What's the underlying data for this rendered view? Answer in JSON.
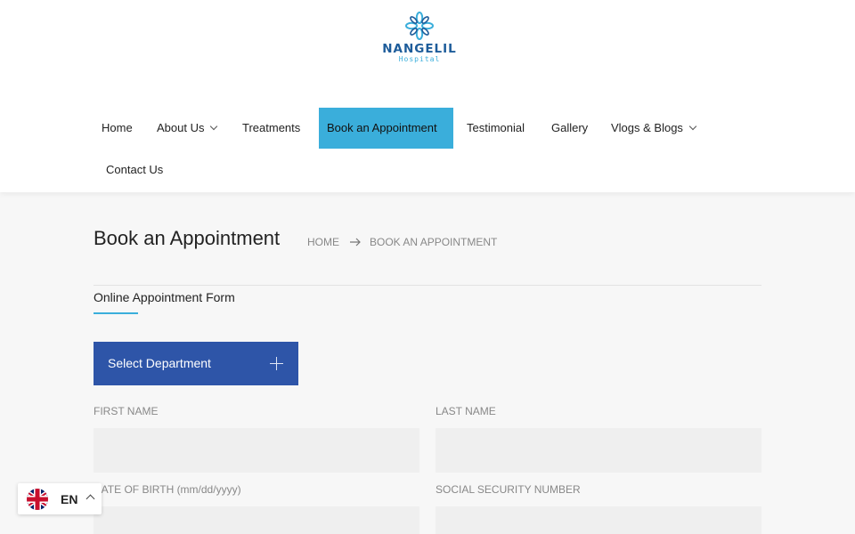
{
  "logo": {
    "name": "NANGELIL",
    "subtitle": "Hospital"
  },
  "nav": {
    "items": [
      {
        "label": "Home"
      },
      {
        "label": "About Us"
      },
      {
        "label": "Treatments"
      },
      {
        "label": "Book an Appointment"
      },
      {
        "label": "Testimonial"
      },
      {
        "label": "Gallery"
      },
      {
        "label": "Vlogs & Blogs"
      },
      {
        "label": "Contact Us"
      }
    ]
  },
  "page": {
    "title": "Book an Appointment",
    "breadcrumb": {
      "home": "HOME",
      "current": "BOOK AN APPOINTMENT"
    }
  },
  "form": {
    "heading": "Online Appointment Form",
    "department_label": "Select Department",
    "fields": {
      "first_name": {
        "label": "FIRST NAME",
        "value": ""
      },
      "last_name": {
        "label": "LAST NAME",
        "value": ""
      },
      "dob": {
        "label": "DATE OF BIRTH (mm/dd/yyyy)",
        "value": ""
      },
      "ssn": {
        "label": "SOCIAL SECURITY NUMBER",
        "value": ""
      }
    }
  },
  "language": {
    "code": "EN",
    "flag": "uk-flag-icon"
  },
  "colors": {
    "accent": "#3aaedb",
    "button": "#2e55a8",
    "brand": "#1d5c9a"
  }
}
